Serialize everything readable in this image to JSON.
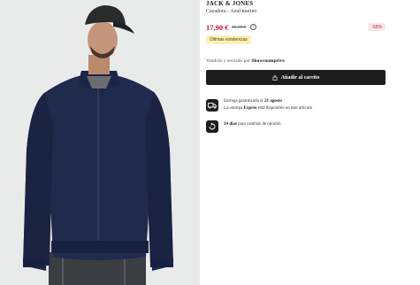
{
  "product": {
    "brand": "JACK & JONES",
    "subtitle": "Cazadora - Azul marino",
    "price": "17,90 €",
    "old_price": "40,00 €",
    "discount": "-55%",
    "stock_badge": "Últimas existencias",
    "seller_prefix": "Vendido y enviado por",
    "seller_name": "Showroomprive",
    "cart_button": "Añadir al carrito"
  },
  "delivery": {
    "line1_prefix": "Entrega garantizada el",
    "line1_date": "21 agosto",
    "line2_prefix": "La entrega",
    "line2_bold": "Exprés",
    "line2_suffix": "está disponible en este artículo"
  },
  "returns": {
    "bold": "14 días",
    "text": "para cambiar de opinión"
  },
  "icons": {
    "info": "info-icon",
    "cart": "shopping-bag-icon",
    "shipping": "delivery-truck-icon",
    "returns": "return-arrow-icon"
  },
  "colors": {
    "price_red": "#c8102e",
    "button_dark": "#1d1d1d",
    "badge_yellow": "#fdf0b6",
    "discount_bg": "#fde7ea"
  }
}
